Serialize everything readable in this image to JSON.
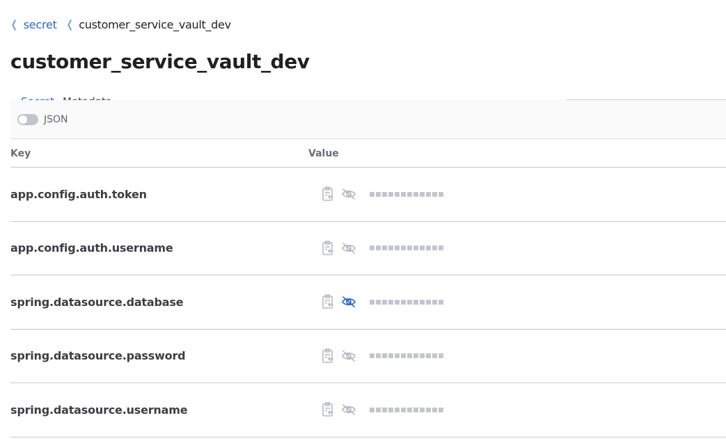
{
  "breadcrumb": {
    "parent_label": "secret",
    "current_label": "customer_service_vault_dev"
  },
  "page_title": "customer_service_vault_dev",
  "tabs": [
    {
      "label": "Secret"
    },
    {
      "label": "Metadata"
    }
  ],
  "toolbar": {
    "json_toggle_label": "JSON",
    "json_toggle_on": false
  },
  "table": {
    "columns": {
      "key": "Key",
      "value": "Value"
    },
    "rows": [
      {
        "key": "app.config.auth.token",
        "masked_chars": 12,
        "revealed_hover": false
      },
      {
        "key": "app.config.auth.username",
        "masked_chars": 12,
        "revealed_hover": false
      },
      {
        "key": "spring.datasource.database",
        "masked_chars": 12,
        "revealed_hover": true
      },
      {
        "key": "spring.datasource.password",
        "masked_chars": 12,
        "revealed_hover": false
      },
      {
        "key": "spring.datasource.username",
        "masked_chars": 12,
        "revealed_hover": false
      }
    ]
  },
  "colors": {
    "link": "#2867d8",
    "icon_muted": "#b7bac2",
    "icon_active": "#2867d8",
    "masked_dot": "#c3c6ce"
  },
  "icons": {
    "copy": "clipboard-copy-icon",
    "reveal": "eye-off-icon",
    "breadcrumb_sep": "chevron-left-icon"
  }
}
